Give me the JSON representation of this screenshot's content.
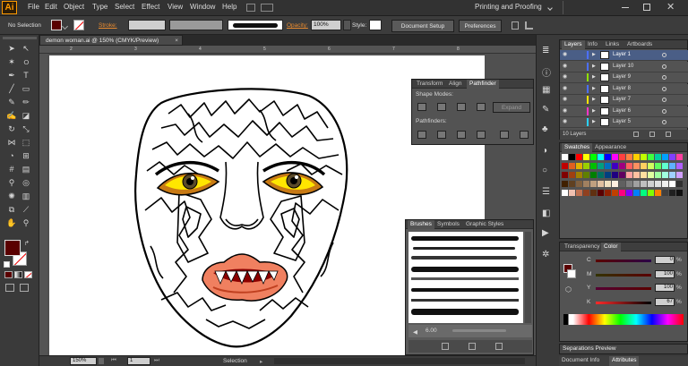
{
  "app": {
    "logo": "Ai",
    "workspace": "Printing and Proofing"
  },
  "menu": [
    "File",
    "Edit",
    "Object",
    "Type",
    "Select",
    "Effect",
    "View",
    "Window",
    "Help"
  ],
  "control_bar": {
    "selection": "No Selection",
    "stroke_label": "Stroke:",
    "opacity_label": "Opacity:",
    "opacity_value": "100%",
    "style_label": "Style:",
    "document_setup": "Document Setup",
    "preferences": "Preferences"
  },
  "document": {
    "tab_title": "demon woman.ai @ 150% (CMYK/Preview)"
  },
  "ruler": {
    "marks": [
      "2",
      "3",
      "4",
      "5",
      "6",
      "7",
      "8"
    ]
  },
  "pathfinder": {
    "tabs": [
      "Transform",
      "Align",
      "Pathfinder"
    ],
    "shape_modes_label": "Shape Modes:",
    "expand_label": "Expand",
    "pathfinders_label": "Pathfinders:"
  },
  "brushes": {
    "tabs": [
      "Brushes",
      "Symbols",
      "Graphic Styles"
    ],
    "size_value": "6.00"
  },
  "layers": {
    "tabs": [
      "Layers",
      "Info",
      "Links",
      "Artboards"
    ],
    "rows": [
      {
        "name": "Layer 1",
        "color": "#4c6fff"
      },
      {
        "name": "Layer 10",
        "color": "#4c6fff"
      },
      {
        "name": "Layer 9",
        "color": "#8fe000"
      },
      {
        "name": "Layer 8",
        "color": "#4c6fff"
      },
      {
        "name": "Layer 7",
        "color": "#ffe600"
      },
      {
        "name": "Layer 6",
        "color": "#ff36c8"
      },
      {
        "name": "Layer 5",
        "color": "#2ad0ff"
      }
    ],
    "count": "10 Layers"
  },
  "swatches": {
    "tabs": [
      "Swatches",
      "Appearance"
    ]
  },
  "color": {
    "tabs": [
      "Transparency",
      "Color"
    ],
    "channels": [
      {
        "label": "C",
        "value": "0",
        "unit": "%"
      },
      {
        "label": "M",
        "value": "100",
        "unit": "%"
      },
      {
        "label": "Y",
        "value": "100",
        "unit": "%"
      },
      {
        "label": "K",
        "value": "67",
        "unit": "%"
      }
    ]
  },
  "separations": {
    "title": "Separations Preview"
  },
  "bottom_tabs": [
    "Document Info",
    "Attributes"
  ],
  "status": {
    "zoom": "150%",
    "artboard": "1",
    "tool": "Selection"
  }
}
